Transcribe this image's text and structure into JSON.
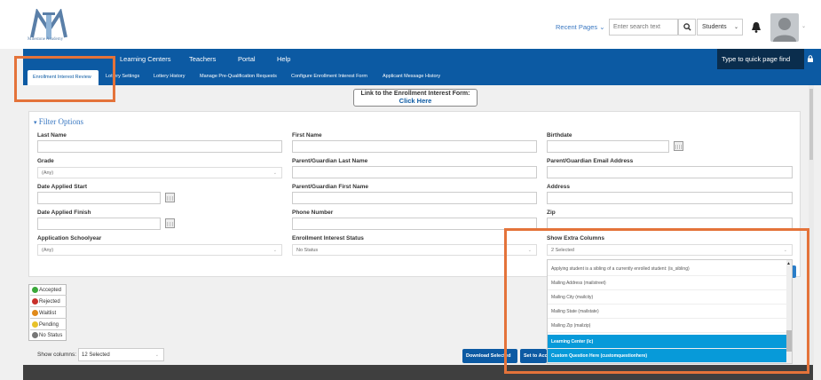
{
  "header": {
    "logo_text": "Milestone Academy",
    "recent_pages": "Recent Pages",
    "search_placeholder": "Enter search text",
    "students_select": "Students"
  },
  "nav": {
    "items": [
      "Learning Centers",
      "Teachers",
      "Portal",
      "Help"
    ],
    "quickpage_placeholder": "Type to quick page find"
  },
  "subnav": {
    "active": "Enrollment Interest Review",
    "items": [
      "Lottery Settings",
      "Lottery History",
      "Manage Pre-Qualification Requests",
      "Configure Enrollment Interest Form",
      "Applicant Message History"
    ]
  },
  "link_box": {
    "line1": "Link to the Enrollment Interest Form:",
    "line2": "Click Here"
  },
  "filters": {
    "title": "Filter Options",
    "last_name": "Last Name",
    "first_name": "First Name",
    "birthdate": "Birthdate",
    "grade": "Grade",
    "grade_value": "(Any)",
    "guardian_last": "Parent/Guardian Last Name",
    "guardian_email": "Parent/Guardian Email Address",
    "date_start": "Date Applied Start",
    "guardian_first": "Parent/Guardian First Name",
    "address": "Address",
    "date_finish": "Date Applied Finish",
    "phone": "Phone Number",
    "zip": "Zip",
    "school_year": "Application Schoolyear",
    "school_year_value": "(Any)",
    "status": "Enrollment Interest Status",
    "status_value": "No Status",
    "extra_cols": "Show Extra Columns",
    "extra_cols_value": "2 Selected"
  },
  "dropdown": {
    "items": [
      {
        "label": "Applying student is a sibling of a currently enrolled student: (is_sibling)",
        "selected": false
      },
      {
        "label": "Mailing Address (mailstreet)",
        "selected": false
      },
      {
        "label": "Mailing City (mailcity)",
        "selected": false
      },
      {
        "label": "Mailing State (mailstate)",
        "selected": false
      },
      {
        "label": "Mailing Zip (mailzip)",
        "selected": false
      },
      {
        "label": "Learning Center (lc)",
        "selected": true
      },
      {
        "label": "Custom Question Here (customquestionhere)",
        "selected": true
      }
    ]
  },
  "legend": [
    {
      "label": "Accepted",
      "color": "#3aa83a"
    },
    {
      "label": "Rejected",
      "color": "#c8302a"
    },
    {
      "label": "Waitlist",
      "color": "#e08a1a"
    },
    {
      "label": "Pending",
      "color": "#e8c22a"
    },
    {
      "label": "No Status",
      "color": "#777777"
    }
  ],
  "bottom": {
    "show_columns_label": "Show columns:",
    "show_columns_value": "12 Selected",
    "download_btn": "Download Selected",
    "set_btn": "Set to Acc"
  }
}
